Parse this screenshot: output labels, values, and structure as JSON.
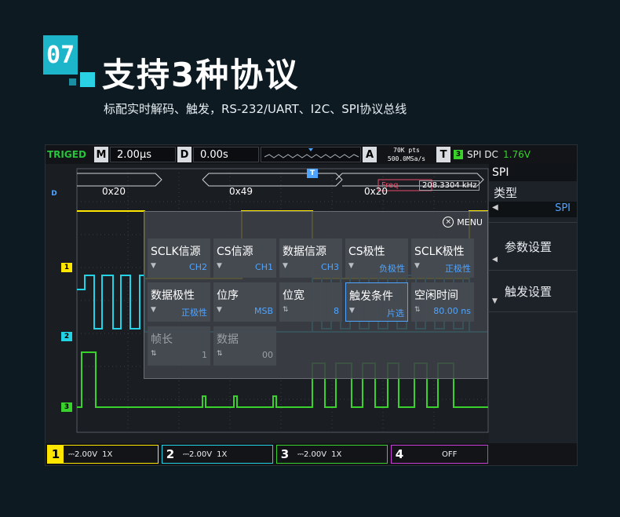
{
  "header": {
    "badge": "07",
    "title": "支持3种协议",
    "subtitle": "标配实时解码、触发，RS-232/UART、I2C、SPI协议总线"
  },
  "topbar": {
    "status": "TRIGED",
    "timebase_label": "M",
    "timebase_value": "2.00μs",
    "delay_label": "D",
    "delay_value": "0.00s",
    "acq_label": "A",
    "acq_pts": "70K pts",
    "acq_rate": "500.0MSa/s",
    "trig_label": "T",
    "trig_source": "3",
    "trig_type": "SPI DC",
    "trig_level": "1.76V"
  },
  "decode": {
    "values": [
      "0x20",
      "0x49",
      "0x20"
    ],
    "freq_label": "Freq",
    "freq_value": "208.3304 kHz"
  },
  "right_panel": {
    "title": "SPI",
    "type_label": "类型",
    "type_value": "SPI",
    "params_label": "参数设置",
    "trigger_label": "触发设置"
  },
  "menu": {
    "menu_label": "MENU",
    "cells": [
      {
        "label": "SCLK信源",
        "value": "CH2"
      },
      {
        "label": "CS信源",
        "value": "CH1"
      },
      {
        "label": "数据信源",
        "value": "CH3"
      },
      {
        "label": "CS极性",
        "value": "负极性"
      },
      {
        "label": "SCLK极性",
        "value": "正极性"
      },
      {
        "label": "数据极性",
        "value": "正极性"
      },
      {
        "label": "位序",
        "value": "MSB"
      },
      {
        "label": "位宽",
        "value": "8"
      },
      {
        "label": "触发条件",
        "value": "片选"
      },
      {
        "label": "空闲时间",
        "value": "80.00 ns"
      },
      {
        "label": "帧长",
        "value": "1"
      },
      {
        "label": "数据",
        "value": "00"
      }
    ]
  },
  "channels": [
    {
      "num": "1",
      "scale": "2.00V",
      "probe": "1X",
      "color": "#ffe600"
    },
    {
      "num": "2",
      "scale": "2.00V",
      "probe": "1X",
      "color": "#22d3e6"
    },
    {
      "num": "3",
      "scale": "2.00V",
      "probe": "1X",
      "color": "#39d12b"
    },
    {
      "num": "4",
      "scale": "",
      "probe": "OFF",
      "color": "#c83cd6"
    }
  ],
  "markers": {
    "trigger": "T",
    "decode": "D"
  }
}
